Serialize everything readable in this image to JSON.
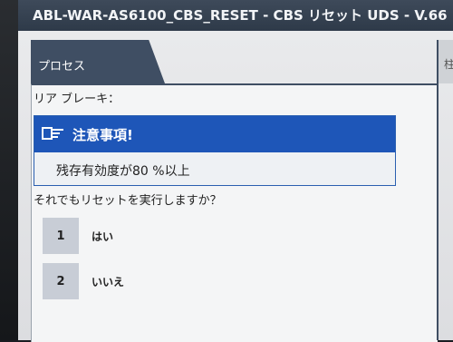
{
  "window": {
    "title": "ABL-WAR-AS6100_CBS_RESET - CBS リセット UDS - V.66"
  },
  "tabs": [
    {
      "label": "プロセス",
      "active": true
    },
    {
      "label": "柱",
      "active": false
    }
  ],
  "panel": {
    "section_label": "リア ブレーキ：",
    "notice": {
      "icon": "pointing-hand-icon",
      "title": "注意事項!",
      "body": "残存有効度が80 %以上"
    },
    "question": "それでもリセットを実行しますか？",
    "options": [
      {
        "number": "1",
        "label": "はい"
      },
      {
        "number": "2",
        "label": "いいえ"
      }
    ]
  },
  "colors": {
    "titlebar": "#33404f",
    "tab_active": "#3f4e63",
    "notice_header": "#1e56b8",
    "option_number_bg": "#c8cdd6"
  }
}
